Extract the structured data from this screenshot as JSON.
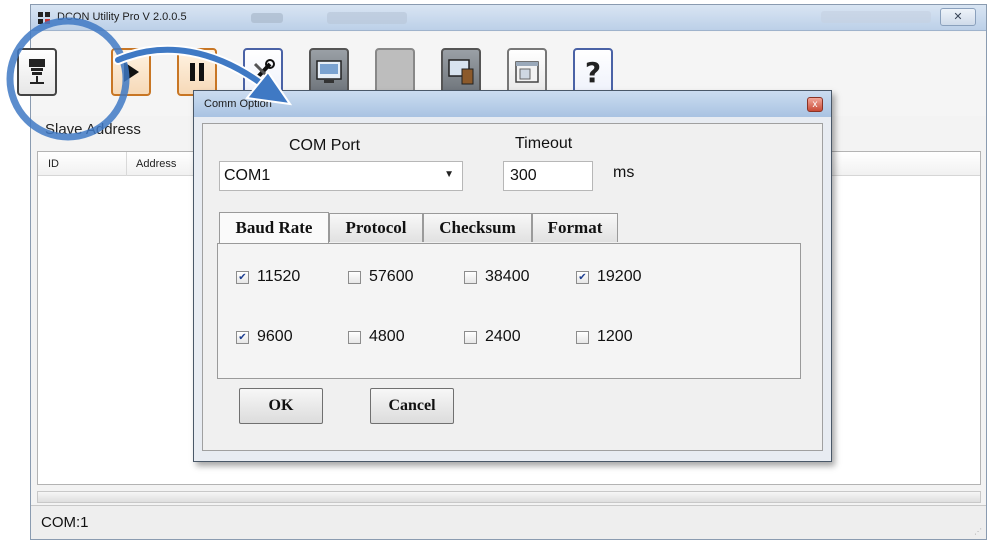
{
  "window": {
    "title": "DCON Utility Pro V 2.0.0.5",
    "close_glyph": "✕"
  },
  "toolbar": {
    "buttons": [
      {
        "name": "search-module-button",
        "icon": "module-icon"
      },
      {
        "name": "run-button",
        "icon": "play-icon"
      },
      {
        "name": "pause-button",
        "icon": "pause-icon"
      },
      {
        "name": "settings-button",
        "icon": "tools-icon"
      },
      {
        "name": "terminal-button",
        "icon": "terminal-icon"
      },
      {
        "name": "blank-button",
        "icon": "blank-icon"
      },
      {
        "name": "connect-button",
        "icon": "computer-icon"
      },
      {
        "name": "window-button",
        "icon": "window-icon"
      },
      {
        "name": "help-button",
        "icon": "help-icon",
        "glyph": "?"
      }
    ]
  },
  "main": {
    "slave_address_label": "Slave Address",
    "columns": [
      "ID",
      "Address"
    ]
  },
  "status_bar": {
    "text": "COM:1"
  },
  "dialog": {
    "title": "Comm Option",
    "close_glyph": "x",
    "com_port_label": "COM Port",
    "com_port_value": "COM1",
    "timeout_label": "Timeout",
    "timeout_value": "300",
    "timeout_unit": "ms",
    "tabs": [
      "Baud Rate",
      "Protocol",
      "Checksum",
      "Format"
    ],
    "active_tab": "Baud Rate",
    "baud_rates": [
      {
        "label": "11520",
        "checked": true
      },
      {
        "label": "57600",
        "checked": false
      },
      {
        "label": "38400",
        "checked": false
      },
      {
        "label": "19200",
        "checked": true
      },
      {
        "label": "9600",
        "checked": true
      },
      {
        "label": "4800",
        "checked": false
      },
      {
        "label": "2400",
        "checked": false
      },
      {
        "label": "1200",
        "checked": false
      }
    ],
    "ok_label": "OK",
    "cancel_label": "Cancel"
  },
  "colors": {
    "annotation": "#3f79c4",
    "title_bar": "#bcd0e8",
    "check": "#1f3f91"
  }
}
